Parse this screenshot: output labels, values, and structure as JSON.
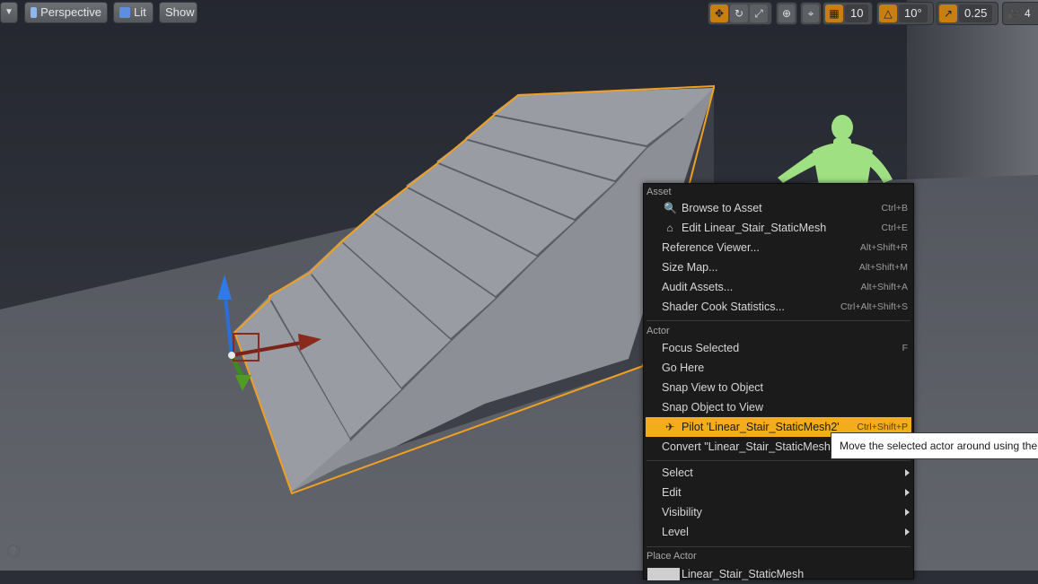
{
  "toolbar": {
    "perspective_label": "Perspective",
    "lit_label": "Lit",
    "show_label": "Show",
    "grid_snap_value": "10",
    "rotation_snap_value": "10°",
    "scale_snap_value": "0.25",
    "camera_speed_value": "4"
  },
  "colors": {
    "accent": "#f3ad1a",
    "selection_outline": "#f0a020",
    "menu_background": "#1b1b1b"
  },
  "context_menu": {
    "asset_header": "Asset",
    "asset_items": [
      {
        "label": "Browse to Asset",
        "shortcut": "Ctrl+B",
        "icon": "magnifier-icon"
      },
      {
        "label": "Edit Linear_Stair_StaticMesh",
        "shortcut": "Ctrl+E",
        "icon": "edit-asset-icon"
      },
      {
        "label": "Reference Viewer...",
        "shortcut": "Alt+Shift+R"
      },
      {
        "label": "Size Map...",
        "shortcut": "Alt+Shift+M"
      },
      {
        "label": "Audit Assets...",
        "shortcut": "Alt+Shift+A"
      },
      {
        "label": "Shader Cook Statistics...",
        "shortcut": "Ctrl+Alt+Shift+S"
      }
    ],
    "actor_header": "Actor",
    "actor_items": [
      {
        "label": "Focus Selected",
        "shortcut": "F"
      },
      {
        "label": "Go Here",
        "shortcut": ""
      },
      {
        "label": "Snap View to Object",
        "shortcut": ""
      },
      {
        "label": "Snap Object to View",
        "shortcut": ""
      },
      {
        "label": "Pilot 'Linear_Stair_StaticMesh2'",
        "shortcut": "Ctrl+Shift+P",
        "icon": "pilot-icon"
      },
      {
        "label": "Convert \"Linear_Stair_StaticMesh2\" To",
        "shortcut": ""
      }
    ],
    "submenu_items": [
      {
        "label": "Select"
      },
      {
        "label": "Edit"
      },
      {
        "label": "Visibility"
      },
      {
        "label": "Level"
      }
    ],
    "place_actor_header": "Place Actor",
    "place_actor_item": "Linear_Stair_StaticMesh"
  },
  "tooltip": {
    "text": "Move the selected actor around using the viewport camera"
  },
  "help": {
    "glyph": "?"
  }
}
